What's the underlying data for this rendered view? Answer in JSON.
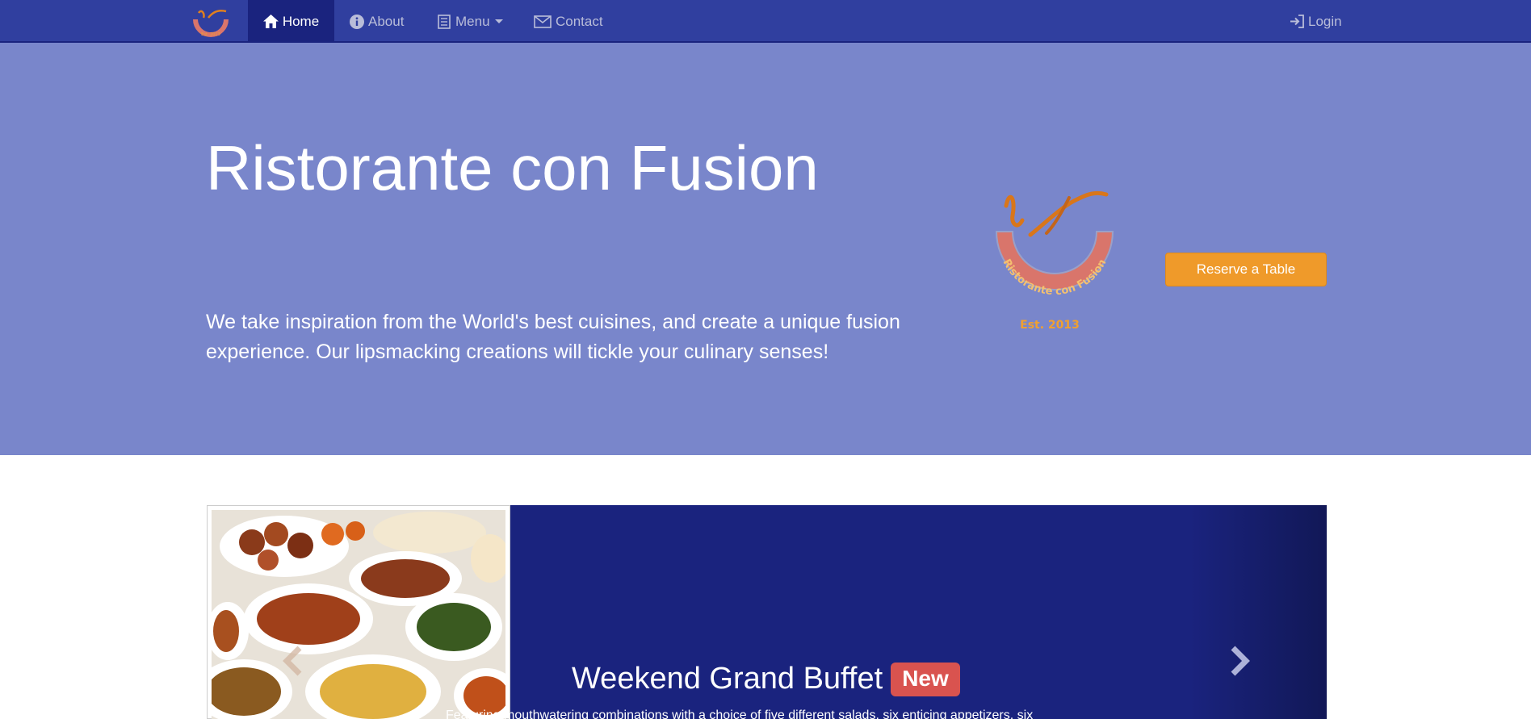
{
  "nav": {
    "brand_logo": "ristorante-logo",
    "items": [
      {
        "label": "Home",
        "icon": "home-icon",
        "active": true
      },
      {
        "label": "About",
        "icon": "info-icon",
        "active": false
      },
      {
        "label": "Menu",
        "icon": "list-icon",
        "active": false
      },
      {
        "label": "Contact",
        "icon": "envelope-icon",
        "active": false
      }
    ],
    "login": {
      "label": "Login",
      "icon": "login-icon"
    }
  },
  "jumbotron": {
    "title": "Ristorante con Fusion",
    "description": "We take inspiration from the World's best cuisines, and create a unique fusion experience. Our lipsmacking creations will tickle your culinary senses!",
    "logo_text": "Ristorante con Fusion",
    "logo_est": "Est. 2013",
    "reserve_button": "Reserve a Table"
  },
  "carousel": {
    "slide_title": "Weekend Grand Buffet",
    "badge": "New",
    "caption": "Featuring mouthwatering combinations with a choice of five different salads, six enticing appetizers, six",
    "prev_icon": "chevron-left-icon",
    "next_icon": "chevron-right-icon"
  },
  "colors": {
    "navbar": "#303f9f",
    "navbar_active": "#1a237e",
    "jumbotron": "#7986cb",
    "carousel": "#1a237e",
    "reserve_button": "#ef9a2a",
    "badge": "#d9534f"
  }
}
